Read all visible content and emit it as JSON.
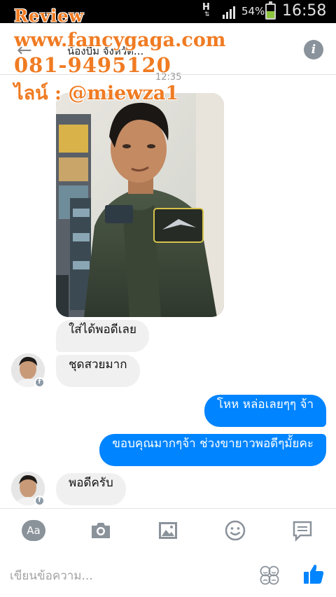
{
  "statusbar": {
    "network": "H",
    "battery": "54%",
    "battery_level": 0.54,
    "time": "16:58"
  },
  "header": {
    "title": "น้องบีม จังหวัด...",
    "icons": {
      "back": "back-arrow-icon",
      "info": "info-icon"
    }
  },
  "watermark": {
    "line1": "Review",
    "line2": "www.fancygaga.com",
    "line3": "081-9495120",
    "line4": "ไลน์ : @miewza1"
  },
  "timestamp": "12:35",
  "messages": [
    {
      "side": "in",
      "text": "ใส่ได้พอดีเลย"
    },
    {
      "side": "in",
      "text": "ชุดสวยมาก"
    },
    {
      "side": "out",
      "text": "โหห  หล่อเลยๆๆ จ้า"
    },
    {
      "side": "out",
      "text": "ขอบคุณมากๆจ้า ช่วงขายาวพอดีๆมั้ยคะ"
    },
    {
      "side": "in",
      "text": "พอดีครับ"
    }
  ],
  "toolbar": {
    "aa_label": "Aa",
    "icons": [
      "text-format-icon",
      "camera-icon",
      "image-icon",
      "emoji-icon",
      "sticker-icon"
    ]
  },
  "composer": {
    "placeholder": "เขียนข้อความ...",
    "value": "",
    "icons": [
      "sticker-face-icon",
      "like-thumb-icon"
    ]
  },
  "colors": {
    "outgoing_bubble": "#0084ff",
    "incoming_bubble": "#f0f0f0",
    "watermark": "#f07b22",
    "like": "#0084ff",
    "icon_gray": "#8a929a"
  }
}
